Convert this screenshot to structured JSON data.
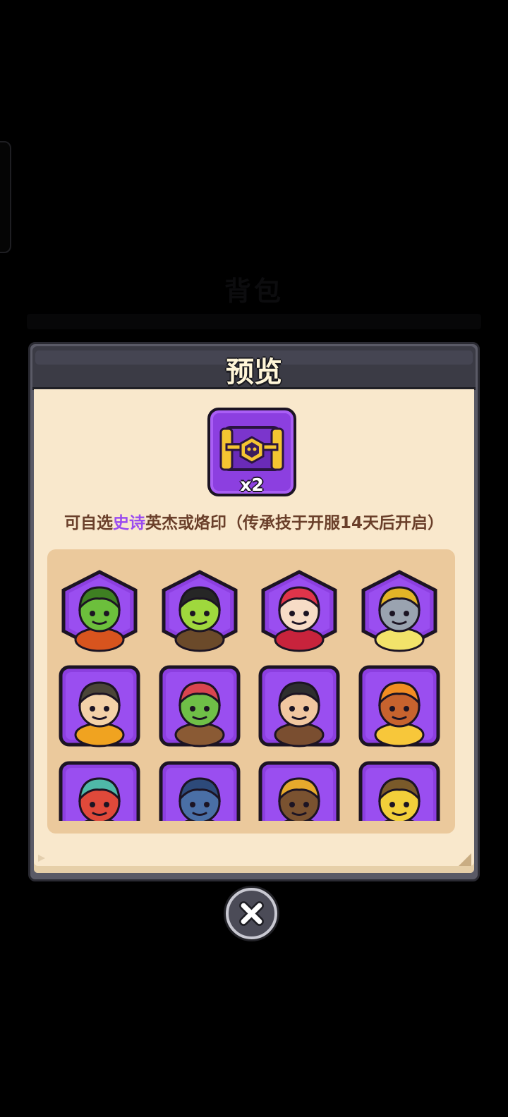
{
  "dialog": {
    "title": "预览",
    "chest": {
      "icon": "epic-chest-icon",
      "count": "x2"
    },
    "description": {
      "prefix": "可自选",
      "highlight": "史诗",
      "suffix": "英杰或烙印（传承技于开服14天后开启）"
    },
    "heroes": [
      {
        "id": "orc-brute-hero-icon",
        "frame": "hexagon"
      },
      {
        "id": "pirate-captain-hero-icon",
        "frame": "hexagon"
      },
      {
        "id": "red-hood-mage-hero-icon",
        "frame": "hexagon"
      },
      {
        "id": "stone-golem-hero-icon",
        "frame": "hexagon"
      },
      {
        "id": "hooded-rogue-hero-icon",
        "frame": "square"
      },
      {
        "id": "goblin-chef-hero-icon",
        "frame": "square"
      },
      {
        "id": "bandana-brawler-hero-icon",
        "frame": "square"
      },
      {
        "id": "flame-spirit-hero-icon",
        "frame": "square"
      },
      {
        "id": "twin-dragon-hero-icon",
        "frame": "square"
      },
      {
        "id": "fish-warrior-hero-icon",
        "frame": "square"
      },
      {
        "id": "monkey-monk-hero-icon",
        "frame": "square"
      },
      {
        "id": "banana-knight-hero-icon",
        "frame": "square"
      }
    ]
  },
  "background": {
    "faded_title": "背包"
  },
  "colors": {
    "epic_purple": "#8c3fe0",
    "highlight": "#9b4cf0",
    "parchment": "#f9e8cc"
  },
  "close": {
    "icon": "close-icon"
  }
}
